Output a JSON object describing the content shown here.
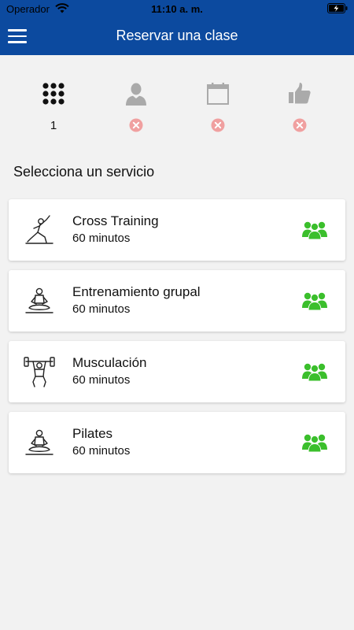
{
  "status_bar": {
    "carrier": "Operador",
    "time": "11:10 a. m."
  },
  "nav": {
    "title": "Reservar una clase",
    "menu_icon": "hamburger-menu-icon"
  },
  "steps": [
    {
      "icon": "grid-icon",
      "value": "1",
      "status": "active"
    },
    {
      "icon": "user-icon",
      "status": "pending"
    },
    {
      "icon": "calendar-icon",
      "status": "pending"
    },
    {
      "icon": "thumbs-up-icon",
      "status": "pending"
    }
  ],
  "section_title": "Selecciona un servicio",
  "services": [
    {
      "name": "Cross Training",
      "duration": "60 minutos",
      "icon": "lunge-figure-icon"
    },
    {
      "name": "Entrenamiento grupal",
      "duration": "60 minutos",
      "icon": "meditation-figure-icon"
    },
    {
      "name": "Musculación",
      "duration": "60 minutos",
      "icon": "weightlifter-icon"
    },
    {
      "name": "Pilates",
      "duration": "60 minutos",
      "icon": "meditation-figure-icon"
    }
  ],
  "colors": {
    "brand_blue": "#0c4a9f",
    "group_green": "#3bbf2c",
    "pending_red": "#f0a0a0"
  }
}
